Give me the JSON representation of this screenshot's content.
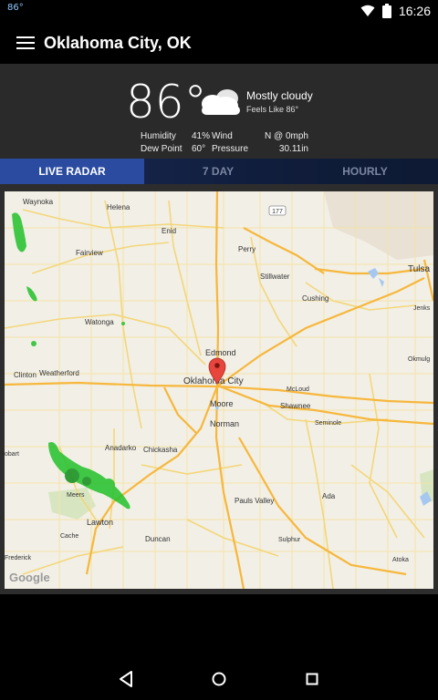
{
  "status_bar": {
    "notification_text": "86°",
    "time": "16:26",
    "icons": [
      "wifi-icon",
      "cell-signal-icon",
      "battery-icon"
    ]
  },
  "app_bar": {
    "title": "Oklahoma City, OK",
    "menu_icon": "hamburger-icon"
  },
  "conditions": {
    "temperature": "86°",
    "condition": "Mostly cloudy",
    "feels_like": "Feels Like 86°",
    "icon": "cloud-icon",
    "humidity_label": "Humidity",
    "humidity_value": "41%",
    "wind_label": "Wind",
    "wind_value": "N @ 0mph",
    "dew_point_label": "Dew Point",
    "dew_point_value": "60°",
    "pressure_label": "Pressure",
    "pressure_value": "30.11in"
  },
  "tabs": [
    {
      "label": "LIVE RADAR",
      "active": true
    },
    {
      "label": "7 DAY",
      "active": false
    },
    {
      "label": "HOURLY",
      "active": false
    }
  ],
  "map": {
    "attribution": "Google",
    "highway_shield": "177",
    "places": {
      "waynoka": "Waynoka",
      "helena": "Helena",
      "enid": "Enid",
      "perry": "Perry",
      "tulsa": "Tulsa",
      "fairview": "Fairview",
      "stillwater": "Stillwater",
      "cushing": "Cushing",
      "jenks": "Jenks",
      "watonga": "Watonga",
      "edmond": "Edmond",
      "okmulgee": "Okmulg",
      "clinton": "Clinton",
      "weatherford": "Weatherford",
      "okc": "Oklahoma City",
      "mcloud": "McLoud",
      "moore": "Moore",
      "shawnee": "Shawnee",
      "norman": "Norman",
      "seminole": "Seminole",
      "hobart": "obart",
      "anadarko": "Anadarko",
      "chickasha": "Chickasha",
      "meers": "Meers",
      "ada": "Ada",
      "paulsvalley": "Pauls Valley",
      "lawton": "Lawton",
      "cache": "Cache",
      "duncan": "Duncan",
      "sulphur": "Sulphur",
      "frederick": "Frederick",
      "atoka": "Atoka"
    }
  },
  "nav": {
    "back": "back-icon",
    "home": "home-icon",
    "recents": "recents-icon"
  },
  "colors": {
    "tab_active": "#2a4ba0",
    "conditions_bg": "#2a2a2a",
    "map_land": "#f2efe6",
    "radar_green": "#22c12a",
    "highway": "#f6b73c",
    "road": "#f3d77a",
    "pin": "#e8453c"
  }
}
